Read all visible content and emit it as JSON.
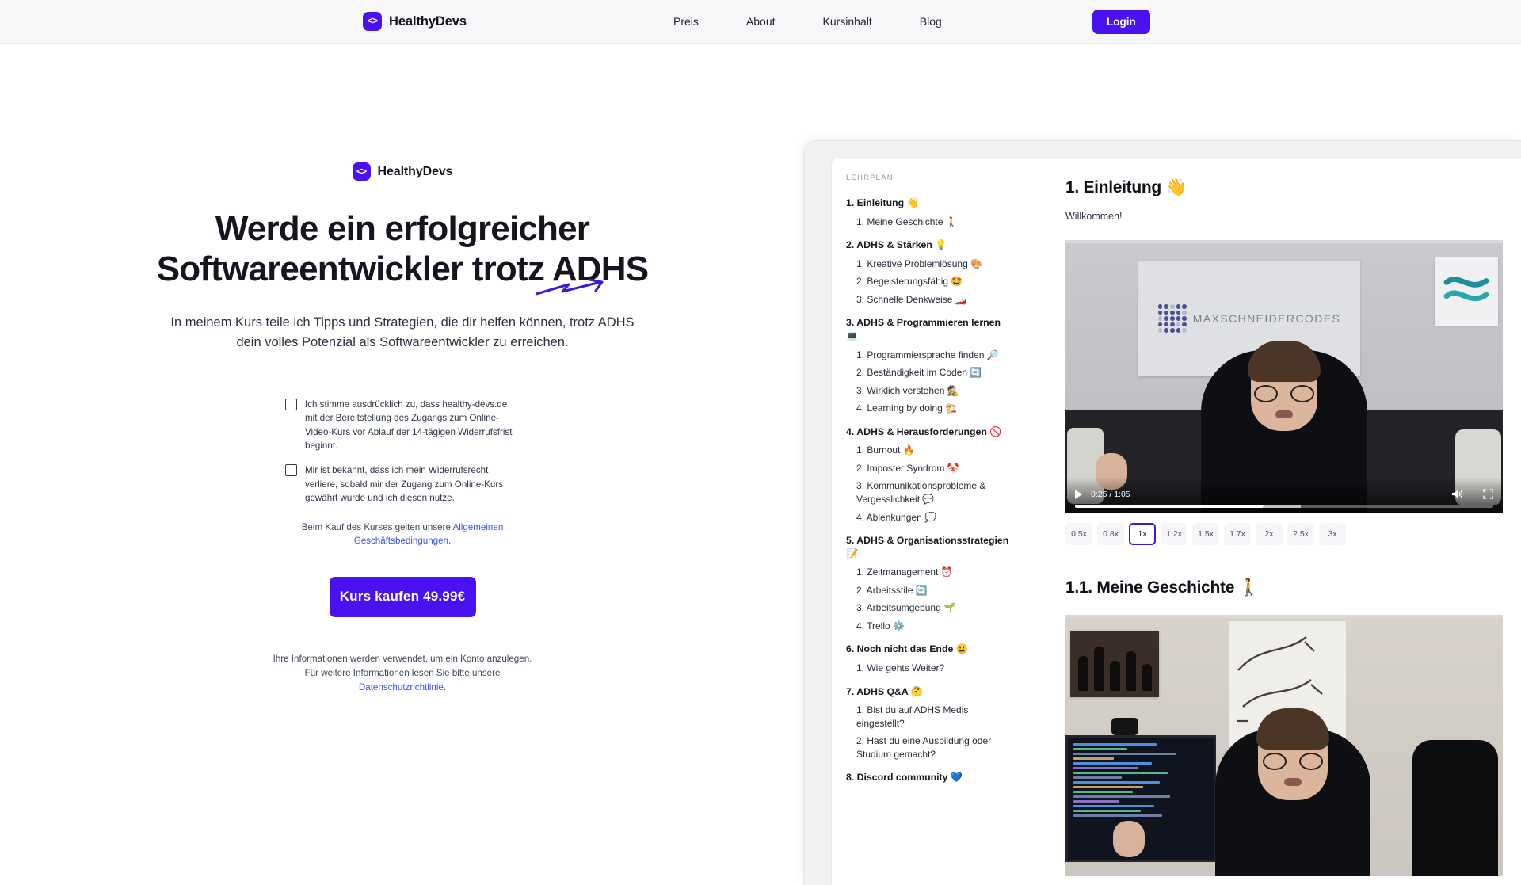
{
  "navbar": {
    "brand": "HealthyDevs",
    "logo_icon": "code-brackets-icon",
    "links": [
      "Preis",
      "About",
      "Kursinhalt",
      "Blog"
    ],
    "login_label": "Login",
    "accent_color": "#4a12f0",
    "background_color": "#f7f7f9"
  },
  "hero": {
    "brand": "HealthyDevs",
    "headline": "Werde ein erfolgreicher Softwareentwickler trotz ADHS",
    "subhead": "In meinem Kurs teile ich Tipps und Strategien, die dir helfen können, trotz ADHS dein volles Potenzial als Softwareentwickler zu erreichen.",
    "checkboxes": [
      {
        "label": "Ich stimme ausdrücklich zu, dass healthy-devs.de mit der Bereitstellung des Zugangs zum Online-Video-Kurs vor Ablauf der 14-tägigen Widerrufsfrist beginnt.",
        "checked": false
      },
      {
        "label": "Mir ist bekannt, dass ich mein Widerrufsrecht verliere, sobald mir der Zugang zum Online-Kurs gewährt wurde und ich diesen nutze.",
        "checked": false
      }
    ],
    "terms_prefix": "Beim Kauf des Kurses gelten unsere ",
    "terms_link": "Allgemeinen Geschäftsbedingungen",
    "terms_suffix": ".",
    "buy_label": "Kurs kaufen  49.99€",
    "price": "49.99€",
    "privacy_prefix": "Ihre Informationen werden verwendet, um ein Konto anzulegen. Für weitere Informationen lesen Sie bitte unsere ",
    "privacy_link": "Datenschutzrichtlinie",
    "privacy_suffix": ".",
    "link_color": "#3755f0"
  },
  "preview": {
    "curriculum_title": "LEHRPLAN",
    "chapters": [
      {
        "title": "1. Einleitung 👋",
        "lessons": [
          "1. Meine Geschichte 🚶"
        ]
      },
      {
        "title": "2. ADHS & Stärken 💡",
        "lessons": [
          "1. Kreative Problemlösung 🎨",
          "2. Begeisterungsfähig 🤩",
          "3. Schnelle Denkweise 🏎️"
        ]
      },
      {
        "title": "3. ADHS & Programmieren lernen 💻",
        "lessons": [
          "1. Programmiersprache finden 🔎",
          "2. Beständigkeit im Coden 🔄",
          "3. Wirklich verstehen 🕵️",
          "4. Learning by doing 🏗️"
        ]
      },
      {
        "title": "4. ADHS & Herausforderungen 🚫",
        "lessons": [
          "1. Burnout 🔥",
          "2. Imposter Syndrom 🤡",
          "3. Kommunikationsprobleme & Vergesslichkeit 💬",
          "4. Ablenkungen 💭"
        ]
      },
      {
        "title": "5. ADHS & Organisationsstrategien 📝",
        "lessons": [
          "1. Zeitmanagement ⏰",
          "2. Arbeitsstile 🔄",
          "3. Arbeitsumgebung 🌱",
          "4. Trello ⚙️"
        ]
      },
      {
        "title": "6. Noch nicht das Ende 😃",
        "lessons": [
          "1. Wie gehts Weiter?"
        ]
      },
      {
        "title": "7. ADHS Q&A 🤔",
        "lessons": [
          "1. Bist du auf ADHS Medis eingestellt?",
          "2. Hast du eine Ausbildung oder Studium gemacht?"
        ]
      },
      {
        "title": "8. Discord community 💙",
        "lessons": []
      }
    ],
    "lesson_heading": "1. Einleitung 👋",
    "lesson_note": "Willkommen!",
    "player": {
      "current_time": "0:25",
      "total_time": "1:05",
      "time_display": "0:25 / 1:05",
      "play_icon": "play-icon",
      "volume_icon": "volume-icon",
      "fullscreen_icon": "fullscreen-icon",
      "progress_percent": 38
    },
    "speeds": [
      "0.5x",
      "0.8x",
      "1x",
      "1.2x",
      "1.5x",
      "1.7x",
      "2x",
      "2.5x",
      "3x"
    ],
    "active_speed": "1x",
    "second_heading": "1.1. Meine Geschichte 🚶",
    "video_one_wall_text": "MAXSCHNEIDERCODES"
  }
}
